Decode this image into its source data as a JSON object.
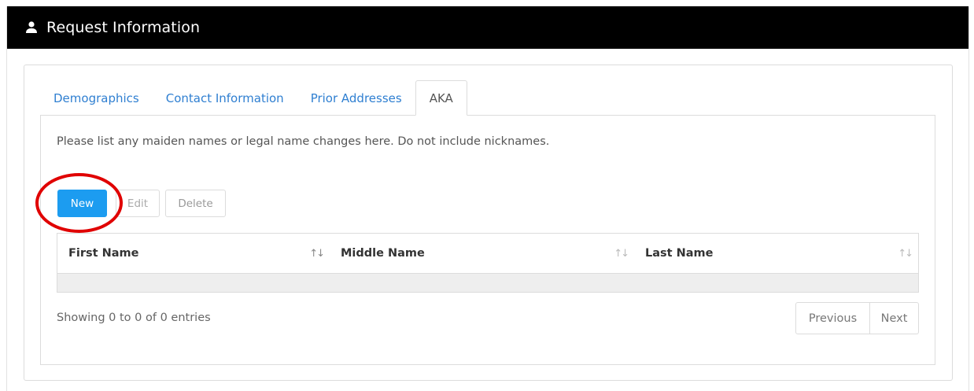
{
  "header": {
    "title": "Request Information",
    "icon": "user-icon"
  },
  "tabs": [
    {
      "label": "Demographics",
      "active": false
    },
    {
      "label": "Contact Information",
      "active": false
    },
    {
      "label": "Prior Addresses",
      "active": false
    },
    {
      "label": "AKA",
      "active": true
    }
  ],
  "panel": {
    "instructions": "Please list any maiden names or legal name changes here. Do not include nicknames."
  },
  "toolbar": {
    "new_label": "New",
    "edit_label": "Edit",
    "delete_label": "Delete"
  },
  "table": {
    "columns": [
      "First Name",
      "Middle Name",
      "Last Name"
    ],
    "rows": []
  },
  "footer": {
    "info": "Showing 0 to 0 of 0 entries",
    "previous_label": "Previous",
    "next_label": "Next"
  },
  "colors": {
    "header_bg": "#000000",
    "tab_link": "#2f7fd1",
    "primary_button": "#1c9cf0",
    "highlight_ring": "#e00000"
  }
}
